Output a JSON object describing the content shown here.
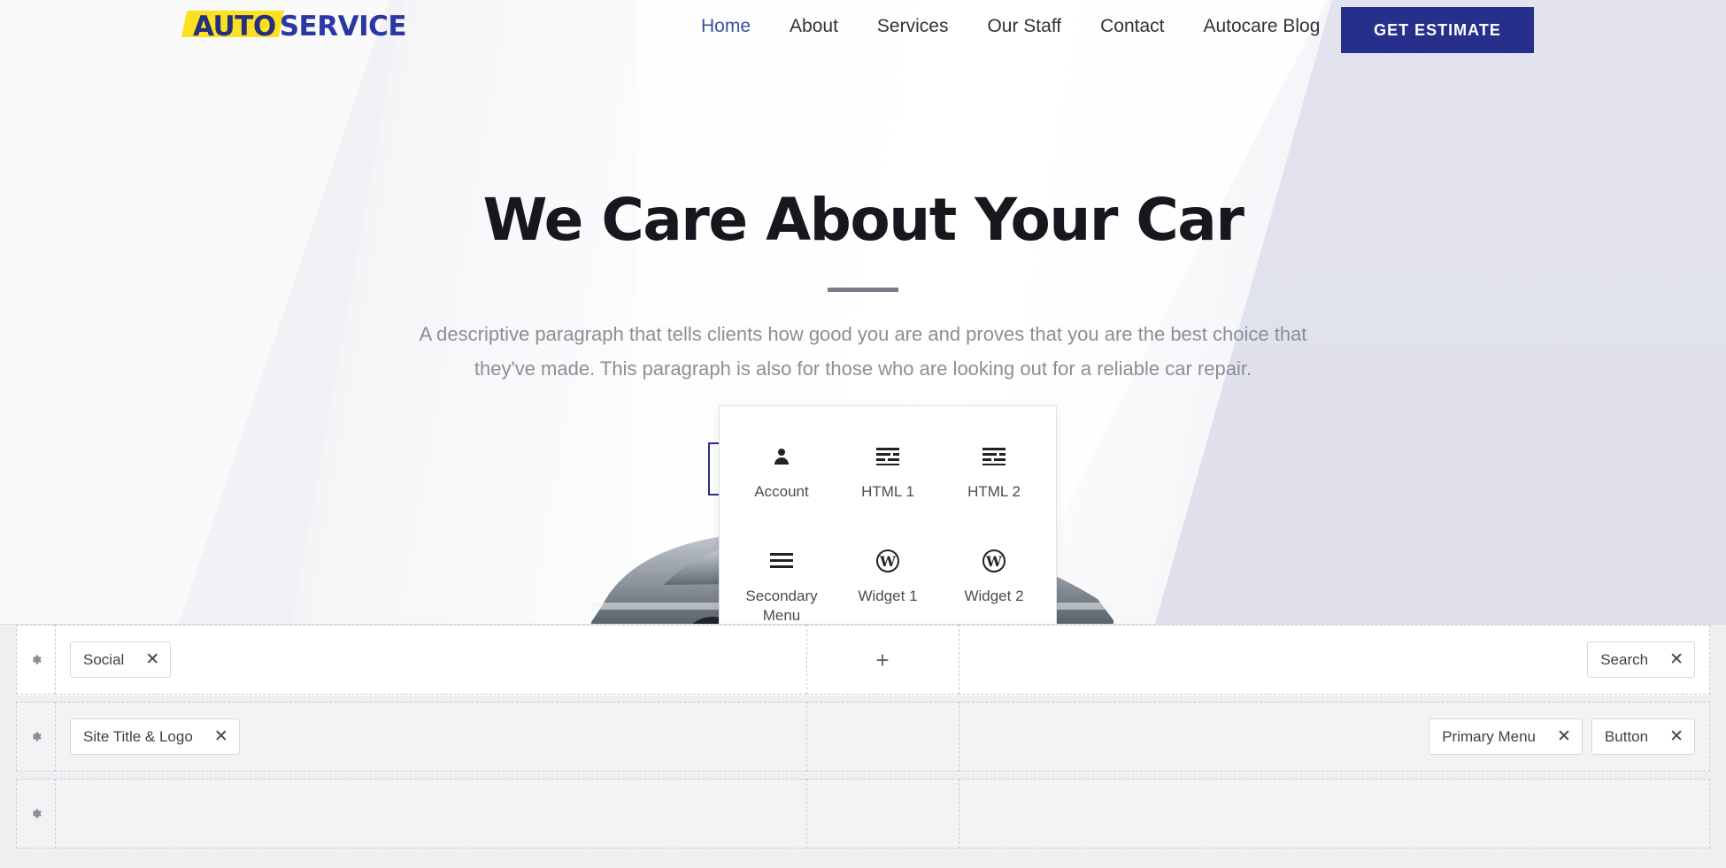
{
  "site": {
    "logo": {
      "part1": "AUTO",
      "part2": "SERVICE",
      "highlight_color": "#fbe122",
      "text_color": "#252f7e"
    },
    "nav": [
      {
        "label": "Home",
        "active": true
      },
      {
        "label": "About",
        "active": false
      },
      {
        "label": "Services",
        "active": false
      },
      {
        "label": "Our Staff",
        "active": false
      },
      {
        "label": "Contact",
        "active": false
      },
      {
        "label": "Autocare Blog",
        "active": false
      }
    ],
    "cta_button": {
      "label": "GET ESTIMATE",
      "bg_color": "#26308b",
      "text_color": "#ffffff"
    },
    "hero": {
      "title": "We Care About Your Car",
      "paragraph": "A descriptive paragraph that tells clients how good you are and proves that you are the best choice that they've made. This paragraph is also for those who are looking out for a reliable car repair."
    }
  },
  "widget_popup": {
    "items": [
      {
        "label": "Account",
        "icon": "person-icon"
      },
      {
        "label": "HTML 1",
        "icon": "text-lines-icon"
      },
      {
        "label": "HTML 2",
        "icon": "text-lines-icon"
      },
      {
        "label": "Secondary Menu",
        "icon": "hamburger-menu-icon"
      },
      {
        "label": "Widget 1",
        "icon": "wordpress-icon"
      },
      {
        "label": "Widget 2",
        "icon": "wordpress-icon"
      }
    ]
  },
  "builder": {
    "rows": [
      {
        "name": "above-header-row",
        "left": [
          {
            "label": "Social"
          }
        ],
        "center_add": "+",
        "right": [
          {
            "label": "Search"
          }
        ]
      },
      {
        "name": "primary-header-row",
        "left": [
          {
            "label": "Site Title & Logo"
          }
        ],
        "center_add": "",
        "right": [
          {
            "label": "Primary Menu"
          },
          {
            "label": "Button"
          }
        ]
      },
      {
        "name": "below-header-row",
        "left": [],
        "center_add": "",
        "right": []
      }
    ],
    "close_glyph": "✕"
  }
}
